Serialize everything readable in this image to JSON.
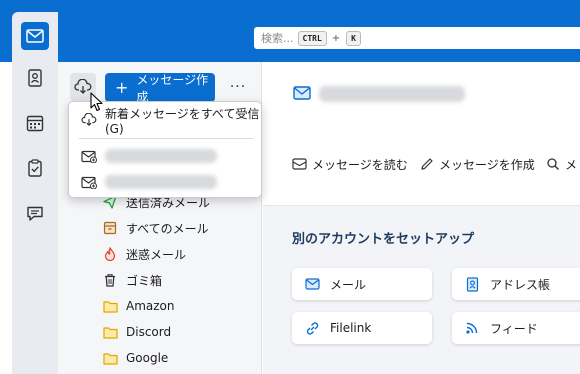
{
  "search": {
    "placeholder": "検索...",
    "key1": "CTRL",
    "joiner": "+",
    "key2": "K"
  },
  "colors": {
    "accent": "#0a6ed1",
    "toolbar": "#0a6ed1",
    "folder_yellow": "#f4b400"
  },
  "spaces": {
    "items": [
      {
        "name": "mail",
        "icon": "mail-icon",
        "active": true
      },
      {
        "name": "address-book",
        "icon": "address-book-icon"
      },
      {
        "name": "calendar",
        "icon": "calendar-icon"
      },
      {
        "name": "tasks",
        "icon": "tasks-icon"
      },
      {
        "name": "chat",
        "icon": "chat-icon"
      }
    ]
  },
  "folderpane": {
    "getmail_icon": "cloud-download-icon",
    "compose_plus": "+",
    "compose_label": "メッセージ作成",
    "more_label": "···",
    "folders": [
      {
        "label": "送信済みメール",
        "icon": "sent-icon"
      },
      {
        "label": "すべてのメール",
        "icon": "archive-icon"
      },
      {
        "label": "迷惑メール",
        "icon": "junk-icon"
      },
      {
        "label": "ゴミ箱",
        "icon": "trash-icon"
      },
      {
        "label": "Amazon",
        "icon": "folder-icon"
      },
      {
        "label": "Discord",
        "icon": "folder-icon"
      },
      {
        "label": "Google",
        "icon": "folder-icon"
      }
    ]
  },
  "popup": {
    "get_all": "新着メッセージをすべて受信(G)",
    "accounts": [
      {
        "icon": "account-mail-icon"
      },
      {
        "icon": "account-mail-icon"
      }
    ]
  },
  "main": {
    "actions": [
      {
        "label": "メッセージを読む",
        "icon": "read-icon"
      },
      {
        "label": "メッセージを作成",
        "icon": "pencil-icon"
      },
      {
        "label": "メ",
        "icon": "search-icon"
      }
    ],
    "setup_title": "別のアカウントをセットアップ",
    "cards": [
      {
        "label": "メール",
        "icon": "mail-icon"
      },
      {
        "label": "アドレス帳",
        "icon": "address-book-icon"
      },
      {
        "label": "Filelink",
        "icon": "link-icon"
      },
      {
        "label": "フィード",
        "icon": "rss-icon"
      }
    ]
  }
}
